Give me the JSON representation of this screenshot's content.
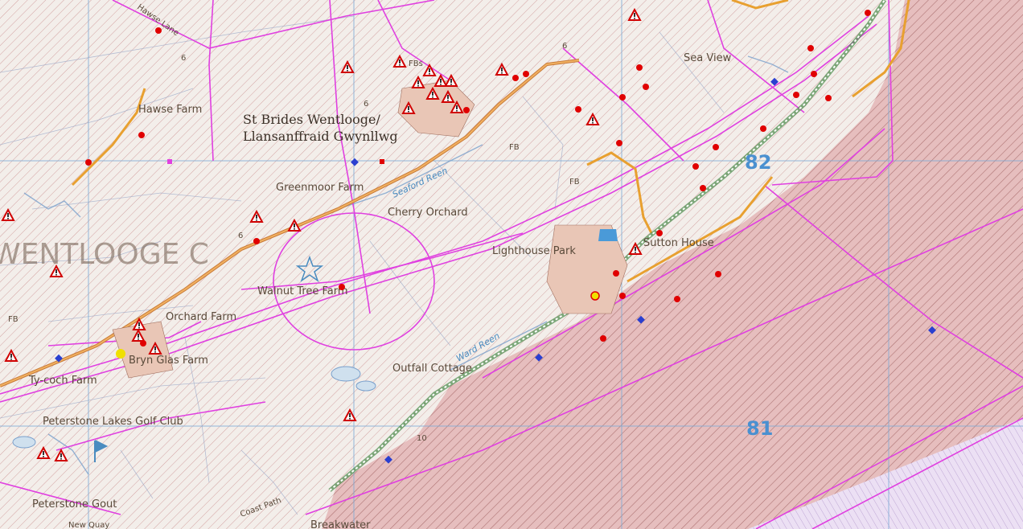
{
  "labels": {
    "hawse_lane": "Hawse Lane",
    "hawse_farm": "Hawse Farm",
    "st_brides": "St Brides Wentlooge/",
    "llansanffraid": "Llansanffraid Gwynllwg",
    "greenmoor_farm": "Greenmoor Farm",
    "cherry_orchard": "Cherry Orchard",
    "wentlooge": "WENTLOOGE C",
    "lighthouse_park": "Lighthouse Park",
    "sutton_house": "Sutton House",
    "sea_view": "Sea View",
    "walnut_tree_farm": "Walnut Tree Farm",
    "orchard_farm": "Orchard Farm",
    "bryn_glas_farm": "Bryn Glas Farm",
    "ty_coch_farm": "Ty-coch Farm",
    "peterstone_lakes": "Peterstone Lakes Golf Club",
    "peterstone_gout": "Peterstone Gout",
    "outfall_cottage": "Outfall Cottage",
    "breakwater": "Breakwater",
    "coast_path": "Coast Path",
    "new_quay": "New Quay",
    "seaford_reen": "Seaford Reen",
    "ward_reen": "Ward Reen",
    "fb": "FB",
    "fbs": "FBs"
  },
  "grid": {
    "label_82": "82",
    "label_81": "81"
  },
  "spot_heights": [
    "6",
    "6",
    "6",
    "6",
    "10"
  ],
  "colors": {
    "land": "#f3eeea",
    "hatch": "#c98a8a",
    "sea": "#e6bebe",
    "designation": "#e040e0",
    "road": "#e8a030",
    "grid": "#7aaad6",
    "warning_red": "#e00000",
    "blue_marker": "#2a3fd0"
  },
  "icons": [
    "warning-triangle-icon",
    "red-dot-icon",
    "blue-diamond-icon",
    "star-icon",
    "fuel-icon",
    "golf-flag-icon"
  ]
}
